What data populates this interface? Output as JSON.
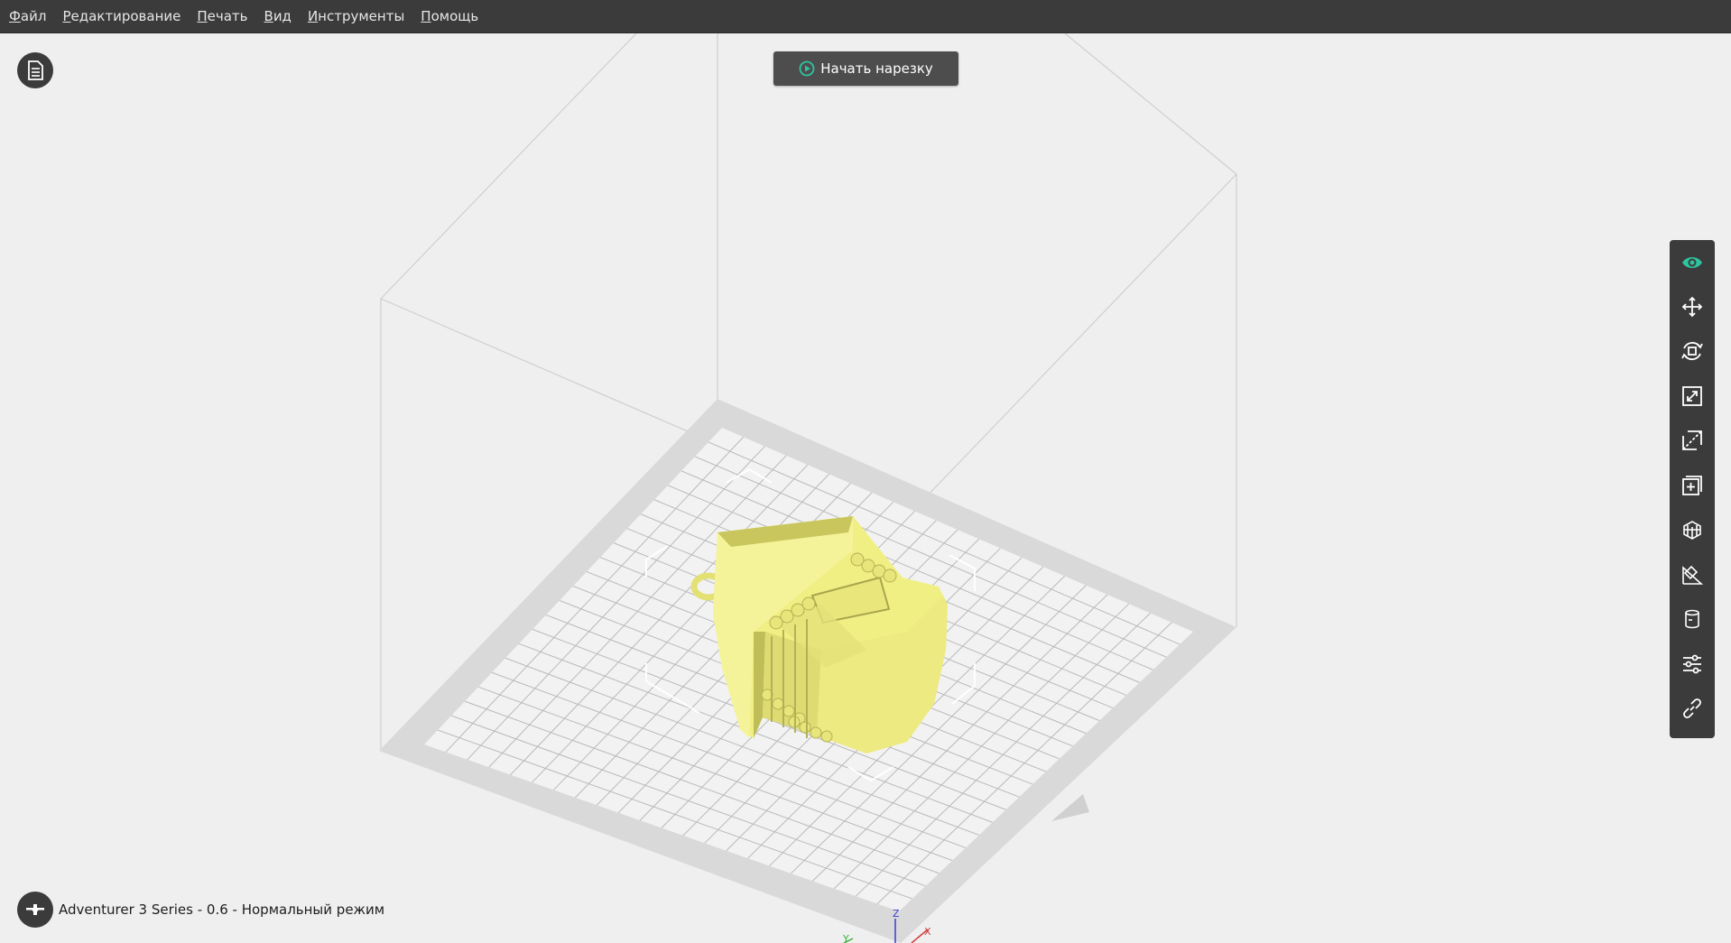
{
  "menu": {
    "items": [
      "Файл",
      "Редактирование",
      "Печать",
      "Вид",
      "Инструменты",
      "Помощь"
    ]
  },
  "slice_button": {
    "label": "Начать нарезку"
  },
  "printer": {
    "label": "Adventurer 3 Series - 0.6 - Нормальный режим"
  },
  "toolbar": {
    "tools": [
      "eye-icon",
      "move-icon",
      "rotate-icon",
      "scale-icon",
      "cut-icon",
      "add-object-icon",
      "support-icon",
      "measure-icon",
      "cylinder-icon",
      "settings-sliders-icon",
      "link-icon"
    ]
  },
  "colors": {
    "accent": "#2ec4a0",
    "model": "#f0ef84",
    "toolbar": "#3b3b3b"
  },
  "axes": {
    "x_label": "X",
    "y_label": "Y",
    "z_label": "Z"
  }
}
